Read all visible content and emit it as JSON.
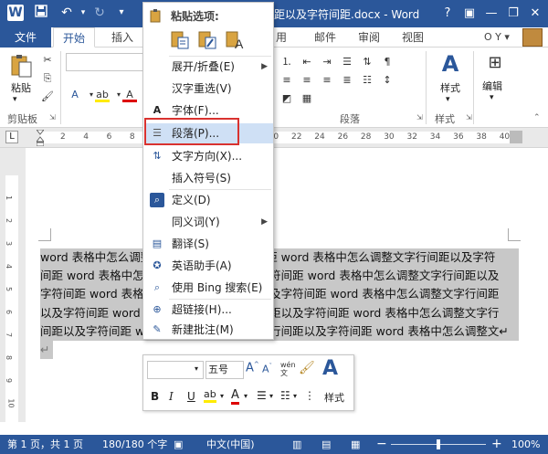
{
  "title_bar": {
    "title": "距以及字符间距.docx - Word",
    "help": "?",
    "minimize": "—",
    "restore": "❐",
    "close": "✕"
  },
  "tabs": {
    "file": "文件",
    "home": "开始",
    "insert": "插入",
    "ref_partial": "用",
    "mailings": "邮件",
    "review": "审阅",
    "view": "视图",
    "user": "O Y ▾"
  },
  "ribbon": {
    "paste": "粘贴",
    "clipboard": "剪贴板",
    "paragraph": "段落",
    "styles_group": "样式",
    "styles_button": "样式",
    "editing": "编辑"
  },
  "ruler": {
    "numbers": [
      "2",
      "4",
      "6",
      "8",
      "10",
      "12",
      "14",
      "16",
      "18",
      "20",
      "22",
      "24",
      "26",
      "28",
      "30",
      "32",
      "34",
      "36",
      "38",
      "40"
    ],
    "left_marker": "L"
  },
  "vruler": {
    "numbers": [
      "1",
      "2",
      "3",
      "4",
      "5",
      "6",
      "7",
      "8",
      "9",
      "10"
    ]
  },
  "document": {
    "lines": [
      "word 表格中怎么调整文字行间距以及字符间距 word 表格中怎么调整文字行间距以及字符",
      "间距 word 表格中怎么调整文字行间距以及字符间距 word 表格中怎么调整文字行间距以及",
      "字符间距 word 表格中怎么调整文字行间距以及字符间距 word 表格中怎么调整文字行间距",
      "以及字符间距 word 表格中怎么调整文字行间距以及字符间距 word 表格中怎么调整文字行",
      "间距以及字符间距 word 表格中怎么调整文字行间距以及字符间距 word 表格中怎么调整文↵"
    ],
    "last_mark": "↵"
  },
  "context_menu": {
    "paste_options_label": "粘贴选项:",
    "items": [
      {
        "label": "展开/折叠(E)",
        "arrow": "▶"
      },
      {
        "label": "汉字重选(V)"
      },
      {
        "label": "字体(F)..."
      },
      {
        "label": "段落(P)..."
      },
      {
        "label": "文字方向(X)..."
      },
      {
        "label": "插入符号(S)"
      },
      {
        "label": "定义(D)"
      },
      {
        "label": "同义词(Y)",
        "arrow": "▶"
      },
      {
        "label": "翻译(S)"
      },
      {
        "label": "英语助手(A)"
      },
      {
        "label": "使用 Bing 搜索(E)"
      },
      {
        "label": "超链接(H)..."
      },
      {
        "label": "新建批注(M)"
      }
    ]
  },
  "mini_toolbar": {
    "font_size": "五号",
    "styles": "样式",
    "bold": "B",
    "italic": "I",
    "underline": "U"
  },
  "status_bar": {
    "page": "第 1 页，共 1 页",
    "words": "180/180 个字",
    "language": "中文(中国)",
    "zoom": "100%"
  },
  "colors": {
    "brand": "#2b579a",
    "highlight_box": "#d9322f",
    "menu_hover": "#cfe0f5"
  }
}
